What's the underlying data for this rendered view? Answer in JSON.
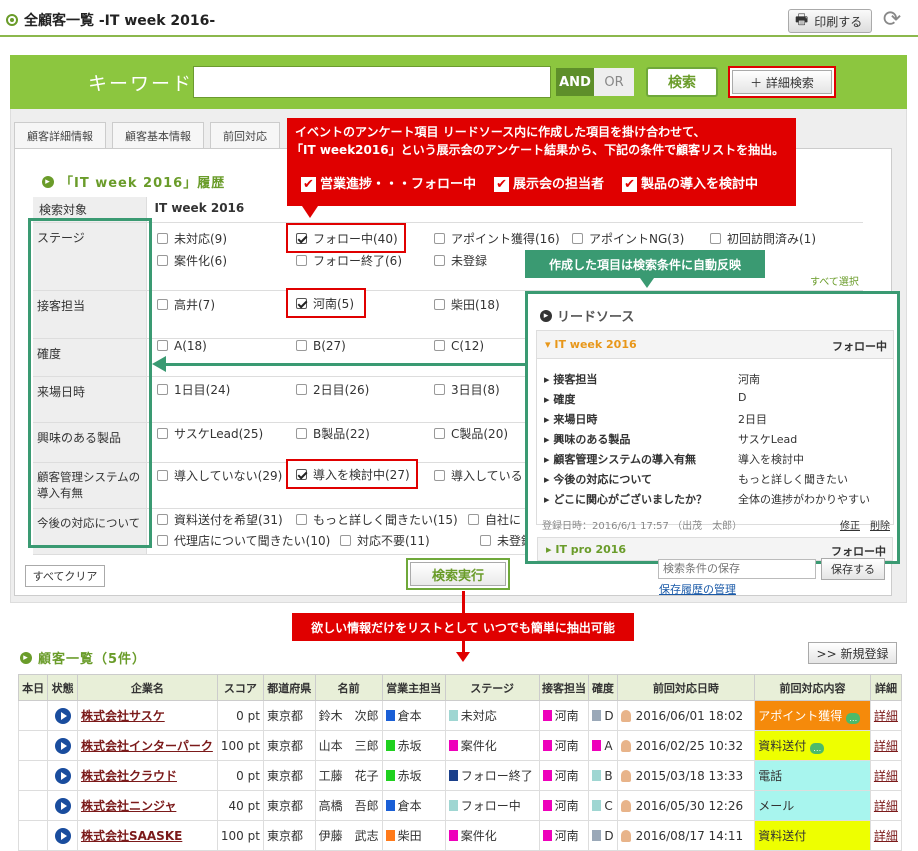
{
  "page": {
    "title": "全顧客一覧 -IT week 2016-",
    "print_label": "印刷する"
  },
  "keyword": {
    "label": "キーワード",
    "value": "",
    "and_label": "AND",
    "or_label": "OR",
    "search_label": "検索",
    "advanced_label": "＋ 詳細検索"
  },
  "tabs": [
    "顧客詳細情報",
    "顧客基本情報",
    "前回対応"
  ],
  "callout_top": {
    "line1": "イベントのアンケート項目 リードソース内に作成した項目を掛け合わせて、",
    "line2": "「IT week2016」という展示会のアンケート結果から、下記の条件で顧客リストを抽出。",
    "checks": [
      "営業進捗・・・フォロー中",
      "展示会の担当者",
      "製品の導入を検討中"
    ]
  },
  "history": {
    "title": "「IT week 2016」履歴",
    "col_label": "検索対象",
    "col_value": "IT week 2016",
    "select_all": "すべて選択"
  },
  "conditions": {
    "stage": {
      "label": "ステージ",
      "options": [
        "未対応(9)",
        "フォロー中(40)",
        "アポイント獲得(16)",
        "アポイントNG(3)",
        "初回訪問済み(1)",
        "案件化(6)",
        "フォロー終了(6)",
        "未登録"
      ]
    },
    "staff": {
      "label": "接客担当",
      "options": [
        "高井(7)",
        "河南(5)",
        "柴田(18)"
      ]
    },
    "certainty": {
      "label": "確度",
      "options": [
        "A(18)",
        "B(27)",
        "C(12)"
      ]
    },
    "visit": {
      "label": "来場日時",
      "options": [
        "1日目(24)",
        "2日目(26)",
        "3日目(8)"
      ]
    },
    "product": {
      "label": "興味のある製品",
      "options": [
        "サスケLead(25)",
        "B製品(22)",
        "C製品(20)"
      ]
    },
    "system": {
      "label": "顧客管理システムの導入有無",
      "options": [
        "導入していない(29)",
        "導入を検討中(27)",
        "導入している"
      ]
    },
    "future": {
      "label": "今後の対応について",
      "options": [
        "資料送付を希望(31)",
        "もっと詳しく聞きたい(15)",
        "自社に",
        "代理店について聞きたい(10)",
        "対応不要(11)",
        "未登録"
      ]
    }
  },
  "callout_auto": "作成した項目は検索条件に自動反映",
  "lead": {
    "title": "リードソース",
    "event1": {
      "name": "IT week 2016",
      "status": "フォロー中"
    },
    "rows": [
      {
        "k": "接客担当",
        "v": "河南"
      },
      {
        "k": "確度",
        "v": "D"
      },
      {
        "k": "来場日時",
        "v": "2日目"
      },
      {
        "k": "興味のある製品",
        "v": "サスケLead"
      },
      {
        "k": "顧客管理システムの導入有無",
        "v": "導入を検討中"
      },
      {
        "k": "今後の対応について",
        "v": "もっと詳しく聞きたい"
      },
      {
        "k": "どこに関心がございましたか？",
        "v": "全体の進捗がわかりやすい"
      }
    ],
    "registered": "登録日時：2016/6/1 17:57 （出茂　太郎）",
    "edit": "修正",
    "delete": "削除",
    "event2": {
      "name": "IT pro 2016",
      "status": "フォロー中"
    }
  },
  "save": {
    "placeholder": "検索条件の保存",
    "button": "保存する",
    "link": "保存履歴の管理"
  },
  "clear_label": "すべてクリア",
  "exec_label": "検索実行",
  "callout_bottom": "欲しい情報だけをリストとして いつでも簡単に抽出可能",
  "list": {
    "title": "顧客一覧（5件）",
    "new_label": ">> 新規登録",
    "headers": [
      "本日",
      "状態",
      "企業名",
      "スコア",
      "都道府県",
      "名前",
      "営業主担当",
      "ステージ",
      "接客担当",
      "確度",
      "前回対応日時",
      "前回対応内容",
      "詳細"
    ],
    "rows": [
      {
        "company": "株式会社サスケ",
        "score": "0 pt",
        "pref": "東京都",
        "name": "鈴木　次郎",
        "owner": "倉本",
        "owner_color": "#1a5fd6",
        "stage": "未対応",
        "stage_color": "#9fd6d2",
        "staff": "河南",
        "rank": "D",
        "rank_color": "#9aa8b8",
        "date": "2016/06/01 18:02",
        "content": "アポイント獲得",
        "content_bg": "#f58a0b",
        "content_color": "#ffffff",
        "bubble": true,
        "detail": "詳細"
      },
      {
        "company": "株式会社インターパーク",
        "score": "100 pt",
        "pref": "東京都",
        "name": "山本　三郎",
        "owner": "赤坂",
        "owner_color": "#1fd11f",
        "stage": "案件化",
        "stage_color": "#ee00bb",
        "staff": "河南",
        "rank": "A",
        "rank_color": "#ee00bb",
        "date": "2016/02/25 10:32",
        "content": "資料送付",
        "content_bg": "#eeff00",
        "content_color": "#333333",
        "bubble": true,
        "detail": "詳細"
      },
      {
        "company": "株式会社クラウド",
        "score": "0 pt",
        "pref": "東京都",
        "name": "工藤　花子",
        "owner": "赤坂",
        "owner_color": "#1fd11f",
        "stage": "フォロー終了",
        "stage_color": "#1a3f8a",
        "staff": "河南",
        "rank": "B",
        "rank_color": "#9fd6d2",
        "date": "2015/03/18 13:33",
        "content": "電話",
        "content_bg": "#a8f5ee",
        "content_color": "#333333",
        "bubble": false,
        "detail": "詳細"
      },
      {
        "company": "株式会社ニンジャ",
        "score": "40 pt",
        "pref": "東京都",
        "name": "高橋　吾郎",
        "owner": "倉本",
        "owner_color": "#1a5fd6",
        "stage": "フォロー中",
        "stage_color": "#9fd6d2",
        "staff": "河南",
        "rank": "C",
        "rank_color": "#9fd6d2",
        "date": "2016/05/30 12:26",
        "content": "メール",
        "content_bg": "#a8f5ee",
        "content_color": "#333333",
        "bubble": false,
        "detail": "詳細"
      },
      {
        "company": "株式会社SAASKE",
        "score": "100 pt",
        "pref": "東京都",
        "name": "伊藤　武志",
        "owner": "柴田",
        "owner_color": "#ff7a1a",
        "stage": "案件化",
        "stage_color": "#ee00bb",
        "staff": "河南",
        "rank": "D",
        "rank_color": "#9aa8b8",
        "date": "2016/08/17 14:11",
        "content": "資料送付",
        "content_bg": "#eeff00",
        "content_color": "#333333",
        "bubble": false,
        "detail": "詳細"
      }
    ]
  }
}
